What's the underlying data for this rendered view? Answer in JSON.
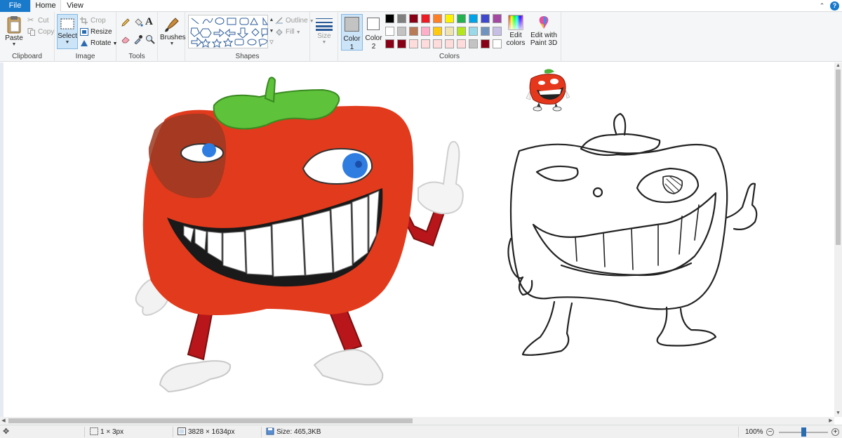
{
  "tabs": {
    "file": "File",
    "home": "Home",
    "view": "View"
  },
  "clipboard": {
    "paste": "Paste",
    "cut": "Cut",
    "copy": "Copy",
    "label": "Clipboard"
  },
  "image": {
    "select": "Select",
    "crop": "Crop",
    "resize": "Resize",
    "rotate": "Rotate",
    "label": "Image"
  },
  "tools": {
    "label": "Tools",
    "text_glyph": "A"
  },
  "brushes": {
    "label": "Brushes"
  },
  "shapes": {
    "label": "Shapes",
    "outline": "Outline",
    "fill": "Fill"
  },
  "size": {
    "label": "Size"
  },
  "color1": {
    "label": "Color",
    "num": "1",
    "value": "#c3c3c3"
  },
  "color2": {
    "label": "Color",
    "num": "2",
    "value": "#ffffff"
  },
  "colors": {
    "label": "Colors",
    "edit_colors_1": "Edit",
    "edit_colors_2": "colors",
    "edit_3d_1": "Edit with",
    "edit_3d_2": "Paint 3D",
    "palette_row1": [
      "#000000",
      "#7f7f7f",
      "#880015",
      "#ed1c24",
      "#ff7f27",
      "#fff200",
      "#22b14c",
      "#00a2e8",
      "#3f48cc",
      "#a349a4"
    ],
    "palette_row2": [
      "#ffffff",
      "#c3c3c3",
      "#b97a57",
      "#ffaec9",
      "#ffc90e",
      "#efe4b0",
      "#b5e61d",
      "#99d9ea",
      "#7092be",
      "#c8bfe7"
    ],
    "palette_row3": [
      "#880015",
      "#880015",
      "#ffdcdc",
      "#ffdcdc",
      "#ffdcdc",
      "#ffdcdc",
      "#ffdcdc",
      "#c3c3c3",
      "#880015",
      "#ffffff"
    ]
  },
  "status": {
    "selection_size": "1 × 3px",
    "image_size": "3828 × 1634px",
    "file_size": "Size: 465,3KB",
    "zoom": "100%",
    "zoom_level": 0.5
  }
}
